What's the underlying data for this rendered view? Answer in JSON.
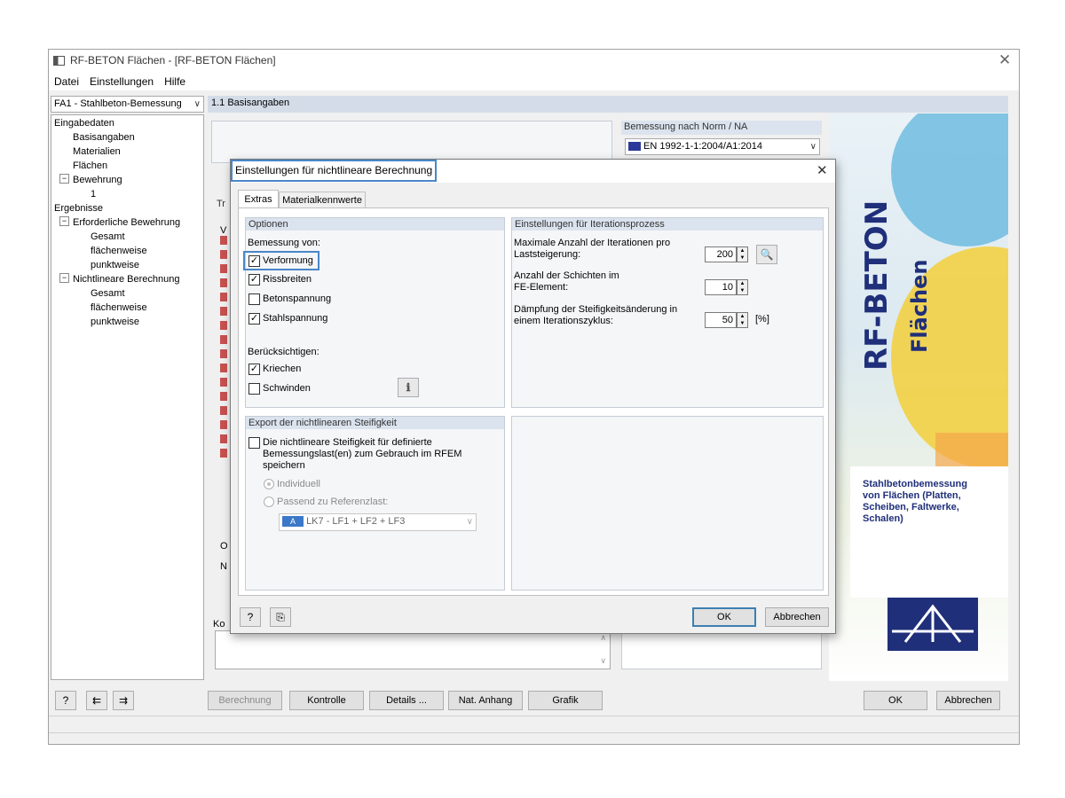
{
  "window": {
    "title": "RF-BETON Flächen - [RF-BETON Flächen]",
    "menu": [
      "Datei",
      "Einstellungen",
      "Hilfe"
    ]
  },
  "case_selector": {
    "value": "FA1 - Stahlbeton-Bemessung"
  },
  "tree": {
    "input_root": "Eingabedaten",
    "input_items": [
      "Basisangaben",
      "Materialien",
      "Flächen"
    ],
    "reinforcement": "Bewehrung",
    "reinforcement_child": "1",
    "results_root": "Ergebnisse",
    "required": "Erforderliche Bewehrung",
    "required_items": [
      "Gesamt",
      "flächenweise",
      "punktweise"
    ],
    "nonlinear": "Nichtlineare Berechnung",
    "nonlinear_items": [
      "Gesamt",
      "flächenweise",
      "punktweise"
    ]
  },
  "main": {
    "header": "1.1 Basisangaben",
    "norm_label": "Bemessung nach Norm / NA",
    "norm_value": "EN 1992-1-1:2004/A1:2014",
    "partial_tab": "Tr",
    "partial_v": "V",
    "partial_o": "O",
    "partial_n": "N",
    "comment_partial": "Ko"
  },
  "logo": {
    "title": "RF-BETON",
    "subtitle": "Flächen",
    "description": "Stahlbetonbemessung von Flächen (Platten, Scheiben, Faltwerke, Schalen)"
  },
  "bottom_bar": {
    "calc": "Berechnung",
    "check": "Kontrolle",
    "details": "Details ...",
    "annex": "Nat. Anhang",
    "graphic": "Grafik",
    "ok": "OK",
    "cancel": "Abbrechen"
  },
  "dialog": {
    "title": "Einstellungen für nichtlineare Berechnung",
    "tabs": [
      "Extras",
      "Materialkennwerte"
    ],
    "options": {
      "title": "Optionen",
      "design_of": "Bemessung von:",
      "deformation": "Verformung",
      "crack_widths": "Rissbreiten",
      "concrete_stress": "Betonspannung",
      "steel_stress": "Stahlspannung",
      "consider": "Berücksichtigen:",
      "creep": "Kriechen",
      "shrinkage": "Schwinden"
    },
    "iteration": {
      "title": "Einstellungen für Iterationsprozess",
      "max_iter_label": "Maximale Anzahl der Iterationen pro Laststeigerung:",
      "max_iter_value": "200",
      "layers_label": "Anzahl der Schichten im FE-Element:",
      "layers_value": "10",
      "damping_label": "Dämpfung der Steifigkeitsänderung in einem Iterationszyklus:",
      "damping_value": "50",
      "damping_unit": "[%]"
    },
    "export": {
      "title": "Export der nichtlinearen Steifigkeit",
      "save_label": "Die nichtlineare Steifigkeit für definierte Bemessungslast(en) zum Gebrauch im RFEM speichern",
      "individual": "Individuell",
      "reference": "Passend zu Referenzlast:",
      "ref_badge": "A",
      "ref_value": "LK7 - LF1 + LF2 + LF3"
    },
    "ok": "OK",
    "cancel": "Abbrechen"
  }
}
